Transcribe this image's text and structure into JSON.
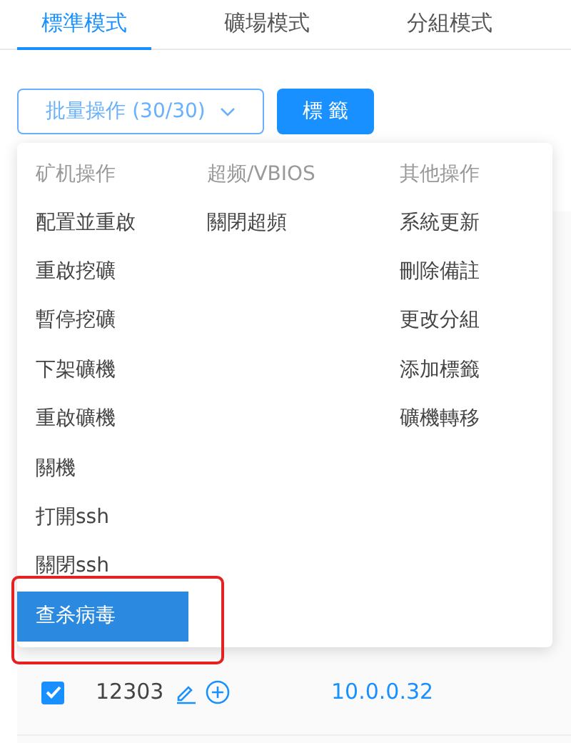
{
  "tabs": [
    {
      "label": "標準模式",
      "selected": true
    },
    {
      "label": "礦場模式",
      "selected": false
    },
    {
      "label": "分組模式",
      "selected": false
    }
  ],
  "toolbar": {
    "batch_button": {
      "label": "批量操作 (30/30)"
    },
    "tag_button": {
      "label": "標 籤"
    }
  },
  "menu": {
    "columns": [
      {
        "header": "矿机操作",
        "items": [
          {
            "label": "配置並重啟",
            "selected": false
          },
          {
            "label": "重啟挖礦",
            "selected": false
          },
          {
            "label": "暫停挖礦",
            "selected": false
          },
          {
            "label": "下架礦機",
            "selected": false
          },
          {
            "label": "重啟礦機",
            "selected": false
          },
          {
            "label": "關機",
            "selected": false
          },
          {
            "label": "打開ssh",
            "selected": false
          },
          {
            "label": "關閉ssh",
            "selected": false
          },
          {
            "label": "查杀病毒",
            "selected": true,
            "annotated": true
          }
        ]
      },
      {
        "header": "超频/VBIOS",
        "items": [
          {
            "label": "關閉超頻",
            "selected": false
          }
        ]
      },
      {
        "header": "其他操作",
        "items": [
          {
            "label": "系統更新",
            "selected": false
          },
          {
            "label": "刪除備註",
            "selected": false
          },
          {
            "label": "更改分組",
            "selected": false
          },
          {
            "label": "添加標籤",
            "selected": false
          },
          {
            "label": "礦機轉移",
            "selected": false
          }
        ]
      }
    ]
  },
  "table": {
    "rows": [
      {
        "checked": true,
        "id": "12303",
        "ip": "10.0.0.32"
      }
    ]
  }
}
